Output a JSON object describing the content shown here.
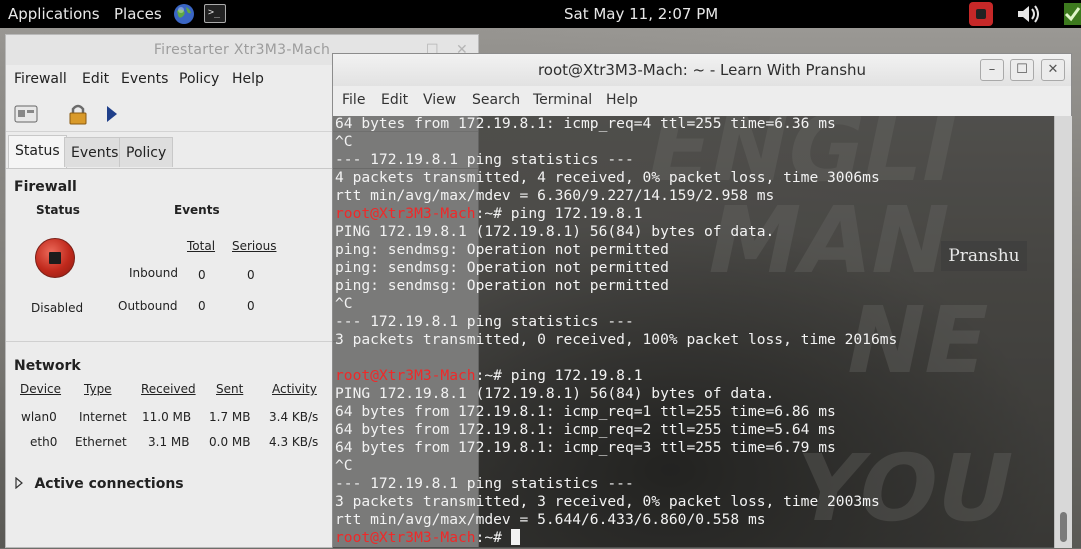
{
  "top_panel": {
    "applications": "Applications",
    "places": "Places",
    "clock": "Sat May 11,  2:07 PM"
  },
  "firestarter": {
    "title": "Firestarter Xtr3M3-Mach",
    "menu": [
      "Firewall",
      "Edit",
      "Events",
      "Policy",
      "Help"
    ],
    "tabs": [
      "Status",
      "Events",
      "Policy"
    ],
    "firewall": {
      "heading": "Firewall",
      "status_label": "Status",
      "events_label": "Events",
      "state": "Disabled",
      "col_total": "Total",
      "col_serious": "Serious",
      "inbound_label": "Inbound",
      "outbound_label": "Outbound",
      "inbound_total": "0",
      "inbound_serious": "0",
      "outbound_total": "0",
      "outbound_serious": "0"
    },
    "network": {
      "heading": "Network",
      "columns": [
        "Device",
        "Type",
        "Received",
        "Sent",
        "Activity"
      ],
      "rows": [
        [
          "wlan0",
          "Internet",
          "11.0 MB",
          "1.7 MB",
          "3.4 KB/s"
        ],
        [
          "eth0",
          "Ethernet",
          "3.1 MB",
          "0.0 MB",
          "4.3 KB/s"
        ]
      ]
    },
    "active_connections": "Active connections"
  },
  "terminal": {
    "title": "root@Xtr3M3-Mach: ~ - Learn With Pranshu",
    "menu": [
      "File",
      "Edit",
      "View",
      "Search",
      "Terminal",
      "Help"
    ],
    "prompt_user": "root@Xtr3M3-Mach",
    "prompt_path": ":~# ",
    "lines": [
      {
        "t": "64 bytes from 172.19.8.1: icmp_req=4 ttl=255 time=6.36 ms"
      },
      {
        "t": "^C"
      },
      {
        "t": "--- 172.19.8.1 ping statistics ---"
      },
      {
        "t": "4 packets transmitted, 4 received, 0% packet loss, time 3006ms"
      },
      {
        "t": "rtt min/avg/max/mdev = 6.360/9.227/14.159/2.958 ms"
      },
      {
        "t": "ping 172.19.8.1",
        "prompt": true
      },
      {
        "t": "PING 172.19.8.1 (172.19.8.1) 56(84) bytes of data."
      },
      {
        "t": "ping: sendmsg: Operation not permitted"
      },
      {
        "t": "ping: sendmsg: Operation not permitted"
      },
      {
        "t": "ping: sendmsg: Operation not permitted"
      },
      {
        "t": "^C"
      },
      {
        "t": "--- 172.19.8.1 ping statistics ---"
      },
      {
        "t": "3 packets transmitted, 0 received, 100% packet loss, time 2016ms"
      },
      {
        "t": ""
      },
      {
        "t": "ping 172.19.8.1",
        "prompt": true
      },
      {
        "t": "PING 172.19.8.1 (172.19.8.1) 56(84) bytes of data."
      },
      {
        "t": "64 bytes from 172.19.8.1: icmp_req=1 ttl=255 time=6.86 ms"
      },
      {
        "t": "64 bytes from 172.19.8.1: icmp_req=2 ttl=255 time=5.64 ms"
      },
      {
        "t": "64 bytes from 172.19.8.1: icmp_req=3 ttl=255 time=6.79 ms"
      },
      {
        "t": "^C"
      },
      {
        "t": "--- 172.19.8.1 ping statistics ---"
      },
      {
        "t": "3 packets transmitted, 3 received, 0% packet loss, time 2003ms"
      },
      {
        "t": "rtt min/avg/max/mdev = 5.644/6.433/6.860/0.558 ms"
      },
      {
        "t": "",
        "prompt": true,
        "cursor": true
      }
    ]
  },
  "wallpaper": {
    "watermark": "Pranshu",
    "letters": [
      "ENGLI",
      "MAN",
      "NE",
      "N",
      "YOU"
    ]
  },
  "colors": {
    "prompt": "#ef2929",
    "terminal_fg": "#f2f2f2",
    "stop_button": "#c0291c"
  },
  "icons": [
    "globe-icon",
    "terminal-launcher-icon",
    "record-stop-icon",
    "volume-icon",
    "network-status-icon",
    "lock-icon",
    "play-icon",
    "firewall-wizard-icon"
  ]
}
